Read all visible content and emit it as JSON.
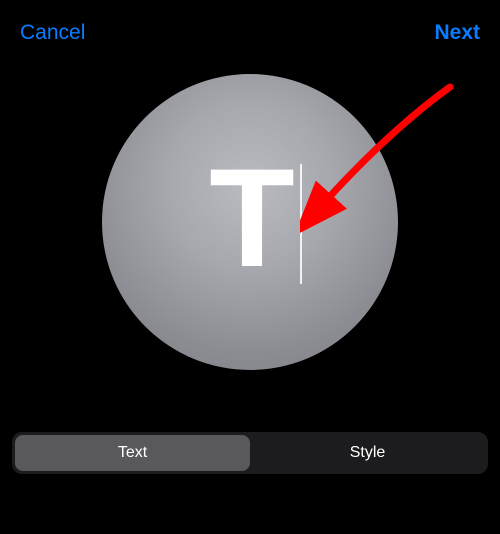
{
  "nav": {
    "cancel_label": "Cancel",
    "next_label": "Next"
  },
  "monogram": {
    "value": "T"
  },
  "segments": {
    "text_label": "Text",
    "style_label": "Style"
  }
}
